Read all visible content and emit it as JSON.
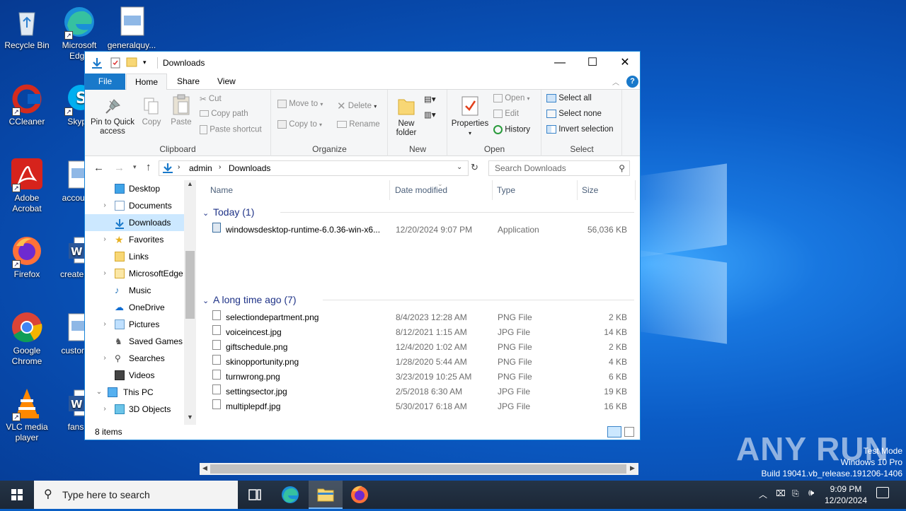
{
  "desktop": {
    "icons": [
      {
        "label": "Recycle Bin"
      },
      {
        "label": "Microsoft Edge"
      },
      {
        "label": "generalquy..."
      },
      {
        "label": "CCleaner"
      },
      {
        "label": "Skype"
      },
      {
        "label": "Adobe Acrobat"
      },
      {
        "label": "accoun..."
      },
      {
        "label": "Firefox"
      },
      {
        "label": "createre..."
      },
      {
        "label": "Google Chrome"
      },
      {
        "label": "customi..."
      },
      {
        "label": "VLC media player"
      },
      {
        "label": "fans..."
      }
    ],
    "watermark": "ANY RUN",
    "test_mode": "Test Mode",
    "edition": "Windows 10 Pro",
    "build": "Build 19041.vb_release.191206-1406"
  },
  "window": {
    "title": "Downloads",
    "tabs": {
      "file": "File",
      "home": "Home",
      "share": "Share",
      "view": "View"
    },
    "ribbon": {
      "clipboard": {
        "label": "Clipboard",
        "pin": "Pin to Quick access",
        "copy": "Copy",
        "paste": "Paste",
        "cut": "Cut",
        "copy_path": "Copy path",
        "paste_shortcut": "Paste shortcut"
      },
      "organize": {
        "label": "Organize",
        "move_to": "Move to",
        "copy_to": "Copy to",
        "delete": "Delete",
        "rename": "Rename"
      },
      "new": {
        "label": "New",
        "new_folder": "New folder"
      },
      "open": {
        "label": "Open",
        "properties": "Properties",
        "open": "Open",
        "edit": "Edit",
        "history": "History"
      },
      "select": {
        "label": "Select",
        "select_all": "Select all",
        "select_none": "Select none",
        "invert": "Invert selection"
      }
    },
    "address": {
      "crumbs": [
        "admin",
        "Downloads"
      ],
      "search_placeholder": "Search Downloads"
    },
    "nav": [
      {
        "label": "Desktop"
      },
      {
        "label": "Documents"
      },
      {
        "label": "Downloads"
      },
      {
        "label": "Favorites"
      },
      {
        "label": "Links"
      },
      {
        "label": "MicrosoftEdge"
      },
      {
        "label": "Music"
      },
      {
        "label": "OneDrive"
      },
      {
        "label": "Pictures"
      },
      {
        "label": "Saved Games"
      },
      {
        "label": "Searches"
      },
      {
        "label": "Videos"
      },
      {
        "label": "This PC"
      },
      {
        "label": "3D Objects"
      }
    ],
    "columns": {
      "name": "Name",
      "date": "Date modified",
      "type": "Type",
      "size": "Size"
    },
    "groups": {
      "today": "Today (1)",
      "older": "A long time ago (7)"
    },
    "files_today": [
      {
        "name": "windowsdesktop-runtime-6.0.36-win-x6...",
        "date": "12/20/2024 9:07 PM",
        "type": "Application",
        "size": "56,036 KB"
      }
    ],
    "files_old": [
      {
        "name": "selectiondepartment.png",
        "date": "8/4/2023 12:28 AM",
        "type": "PNG File",
        "size": "2 KB"
      },
      {
        "name": "voiceincest.jpg",
        "date": "8/12/2021 1:15 AM",
        "type": "JPG File",
        "size": "14 KB"
      },
      {
        "name": "giftschedule.png",
        "date": "12/4/2020 1:02 AM",
        "type": "PNG File",
        "size": "2 KB"
      },
      {
        "name": "skinopportunity.png",
        "date": "1/28/2020 5:44 AM",
        "type": "PNG File",
        "size": "4 KB"
      },
      {
        "name": "turnwrong.png",
        "date": "3/23/2019 10:25 AM",
        "type": "PNG File",
        "size": "6 KB"
      },
      {
        "name": "settingsector.jpg",
        "date": "2/5/2018 6:30 AM",
        "type": "JPG File",
        "size": "19 KB"
      },
      {
        "name": "multiplepdf.jpg",
        "date": "5/30/2017 6:18 AM",
        "type": "JPG File",
        "size": "16 KB"
      }
    ],
    "status": "8 items"
  },
  "taskbar": {
    "search_placeholder": "Type here to search",
    "time": "9:09 PM",
    "date": "12/20/2024"
  },
  "colors": {
    "accent": "#1979ca",
    "selection": "#cce8ff",
    "group_header": "#1e3287"
  }
}
